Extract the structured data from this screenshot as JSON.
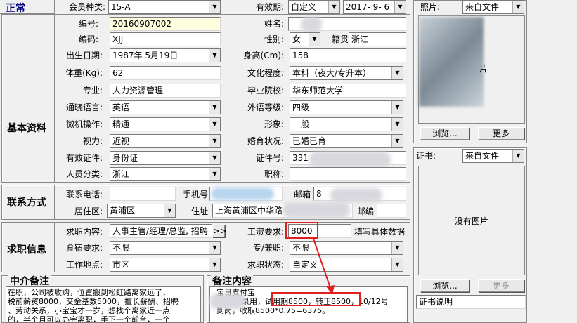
{
  "sections": {
    "top": "正常",
    "basic": "基本资料",
    "contact": "联系方式",
    "job": "求职信息"
  },
  "fields": {
    "member_type": {
      "label": "会员种类:",
      "value": "15-A"
    },
    "validity": {
      "label": "有效期:",
      "mode": "自定义",
      "date": "2017- 9- 6"
    },
    "photo": {
      "label": "照片:",
      "source": "来自文件"
    },
    "id_no": {
      "label": "编号:",
      "value": "20160907002"
    },
    "name": {
      "label": "姓名:"
    },
    "code": {
      "label": "编码:",
      "value": "XJJ"
    },
    "gender": {
      "label": "性别:",
      "value": "女"
    },
    "native": {
      "label": "籍贯",
      "value": "浙江"
    },
    "birth": {
      "label": "出生日期:",
      "value": "1987年 5月19日"
    },
    "height": {
      "label": "身高(Cm):",
      "value": "158"
    },
    "weight": {
      "label": "体重(Kg):",
      "value": "62"
    },
    "education": {
      "label": "文化程度:",
      "value": "本科（夜大/专升本）"
    },
    "major": {
      "label": "专业:",
      "value": "人力资源管理"
    },
    "school": {
      "label": "毕业院校:",
      "value": "华东师范大学"
    },
    "language": {
      "label": "通晓语言:",
      "value": "英语"
    },
    "foreign_level": {
      "label": "外语等级:",
      "value": "四级"
    },
    "computer": {
      "label": "微机操作:",
      "value": "精通"
    },
    "appearance": {
      "label": "形象:",
      "value": "一般"
    },
    "vision": {
      "label": "视力:",
      "value": "近视"
    },
    "marital": {
      "label": "婚育状况:",
      "value": "已婚已育"
    },
    "id_type": {
      "label": "有效证件:",
      "value": "身份证"
    },
    "id_number": {
      "label": "证件号:",
      "value": "331"
    },
    "category": {
      "label": "人员分类:",
      "value": "浙江"
    },
    "title": {
      "label": "职称:"
    },
    "phone": {
      "label": "联系电话:"
    },
    "mobile": {
      "label": "手机号"
    },
    "email": {
      "label": "邮箱",
      "value": "8"
    },
    "district": {
      "label": "居住区:",
      "value": "黄浦区"
    },
    "address": {
      "label": "住址",
      "value": "上海黄浦区中华路"
    },
    "postcode": {
      "label": "邮编"
    },
    "job_content": {
      "label": "求职内容:",
      "value": "人事主管/经理/总监, 招聘",
      "more": ">>"
    },
    "salary": {
      "label": "工资要求:",
      "value": "8000",
      "hint": "填写具体数据"
    },
    "meals": {
      "label": "食宿要求:",
      "value": "不限"
    },
    "fulltime": {
      "label": "专/兼职:",
      "value": "不限"
    },
    "workplace": {
      "label": "工作地点:",
      "value": "市区"
    },
    "job_status": {
      "label": "求职状态:",
      "value": "自定义"
    },
    "cert": {
      "label": "证书:",
      "source": "来自文件"
    }
  },
  "buttons": {
    "browse": "浏览...",
    "more": "更多",
    "browse2": "浏览...",
    "more2": "更多"
  },
  "photo_text": "片",
  "no_image": "没有图片",
  "cert_note": "证书说明",
  "agent_note": {
    "title": "中介备注",
    "lines": [
      "在职，公司被收购，位置搬到松虹路离家远了，",
      "税前薪资8000，交金基数5000，擅长薪酬、招聘",
      "、劳动关系，小宝宝才一岁，想找个离家近一点",
      "的，半个月可以办完离职，手下一个前台，一个"
    ]
  },
  "remark": {
    "title": "备注内容",
    "lines": [
      "  宝日支付宝",
      "      意向录用，试用期8500，转正8500，10/12号",
      "  到岗，收取8500*0.75=6375。"
    ]
  },
  "colors": {
    "accent": "#000080",
    "highlight": "#e02020"
  }
}
